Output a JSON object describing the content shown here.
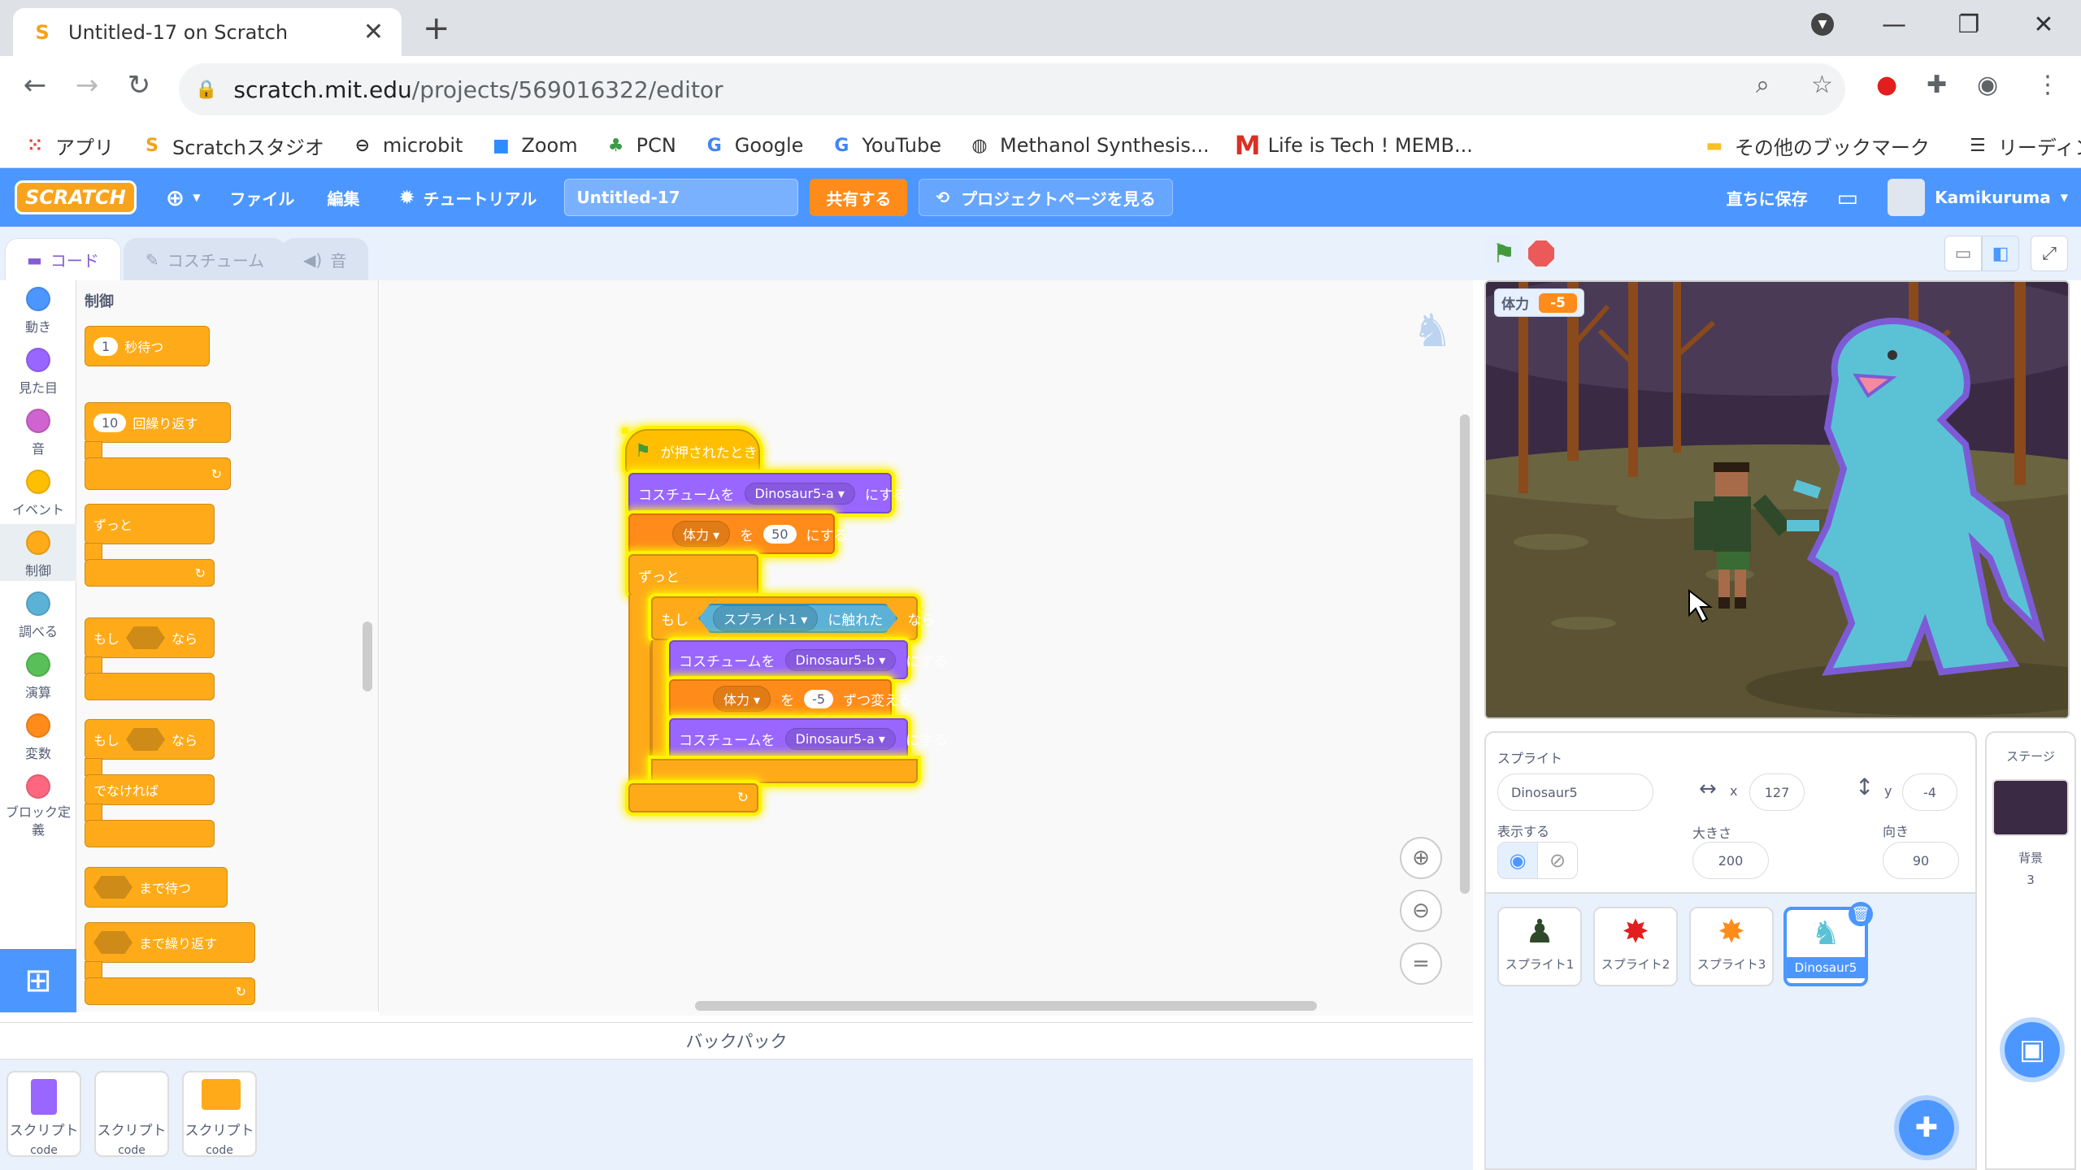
{
  "browser": {
    "tab_title": "Untitled-17 on Scratch",
    "url_host": "scratch.mit.edu",
    "url_path": "/projects/569016322/editor",
    "bookmarks": [
      "アプリ",
      "Scratchスタジオ",
      "microbit",
      "Zoom",
      "PCN",
      "Google",
      "YouTube",
      "Methanol Synthesis...",
      "Life is Tech ! MEMB..."
    ],
    "other_bookmarks": "その他のブックマーク",
    "reading_list": "リーディング リスト"
  },
  "menubar": {
    "logo": "SCRATCH",
    "file": "ファイル",
    "edit": "編集",
    "tutorial": "チュートリアル",
    "project_title": "Untitled-17",
    "share": "共有する",
    "see_project_page": "プロジェクトページを見る",
    "save_now": "直ちに保存",
    "username": "Kamikuruma"
  },
  "editor_tabs": {
    "code": "コード",
    "costume": "コスチューム",
    "sound": "音"
  },
  "categories": [
    {
      "label": "動き",
      "color": "#4c97ff"
    },
    {
      "label": "見た目",
      "color": "#9966ff"
    },
    {
      "label": "音",
      "color": "#cf63cf"
    },
    {
      "label": "イベント",
      "color": "#ffbf00"
    },
    {
      "label": "制御",
      "color": "#ffab19"
    },
    {
      "label": "調べる",
      "color": "#5cb1d6"
    },
    {
      "label": "演算",
      "color": "#59c059"
    },
    {
      "label": "変数",
      "color": "#ff8c1a"
    },
    {
      "label": "ブロック定義",
      "color": "#ff6680"
    }
  ],
  "palette": {
    "title": "制御",
    "wait_num": "1",
    "wait_label": "秒待つ",
    "repeat_num": "10",
    "repeat_label": "回繰り返す",
    "forever": "ずっと",
    "if": "もし",
    "then": "なら",
    "else": "でなければ",
    "wait_until": "まで待つ",
    "repeat_until": "まで繰り返す"
  },
  "script": {
    "hat": "が押されたとき",
    "costume1_pre": "コスチュームを",
    "costume1_val": "Dinosaur5-a",
    "costume1_post": "にする",
    "var1_name": "体力",
    "var1_to": "を",
    "var1_val": "50",
    "var1_post": "にする",
    "forever": "ずっと",
    "if": "もし",
    "touching_target": "スプライト1",
    "touching": "に触れた",
    "then": "なら",
    "costume2_pre": "コスチュームを",
    "costume2_val": "Dinosaur5-b",
    "costume2_post": "にする",
    "change_name": "体力",
    "change_to": "を",
    "change_val": "-5",
    "change_post": "ずつ変える",
    "costume3_pre": "コスチュームを",
    "costume3_val": "Dinosaur5-a",
    "costume3_post": "にする"
  },
  "backpack": {
    "title": "バックパック",
    "items": [
      {
        "label": "スクリプト",
        "sub": "code"
      },
      {
        "label": "スクリプト",
        "sub": "code"
      },
      {
        "label": "スクリプト",
        "sub": "code"
      }
    ]
  },
  "stage": {
    "monitor_label": "体力",
    "monitor_value": "-5"
  },
  "sprite_info": {
    "sprite_label": "スプライト",
    "sprite_name": "Dinosaur5",
    "x_label": "x",
    "x": "127",
    "y_label": "y",
    "y": "-4",
    "show_label": "表示する",
    "size_label": "大きさ",
    "size": "200",
    "direction_label": "向き",
    "direction": "90"
  },
  "sprites": [
    "スプライト1",
    "スプライト2",
    "スプライト3",
    "Dinosaur5"
  ],
  "stage_panel": {
    "title": "ステージ",
    "backdrop_label": "背景",
    "backdrop_count": "3"
  }
}
